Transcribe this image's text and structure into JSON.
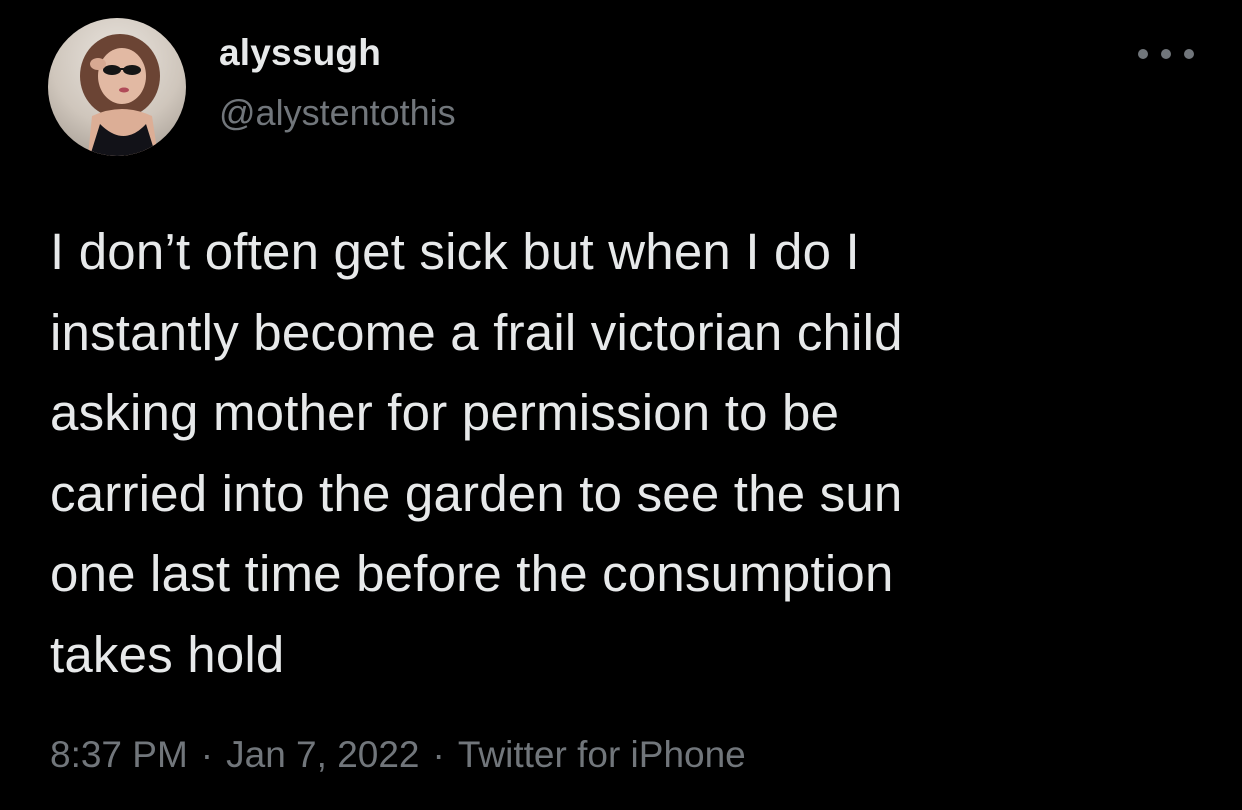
{
  "tweet": {
    "user": {
      "display_name": "alyssugh",
      "handle": "@alystentothis",
      "avatar_icon": "profile-photo"
    },
    "more_icon": "more-horizontal-icon",
    "text": "I don’t often get sick but when I do I\ninstantly become a frail victorian child\nasking mother for permission to be\ncarried into the garden to see the sun\none last time before the consumption\ntakes hold",
    "time": "8:37 PM",
    "separator": "·",
    "date": "Jan 7, 2022",
    "source": "Twitter for iPhone"
  },
  "colors": {
    "background": "#000000",
    "primary_text": "#e7e9ea",
    "secondary_text": "#71767b"
  }
}
